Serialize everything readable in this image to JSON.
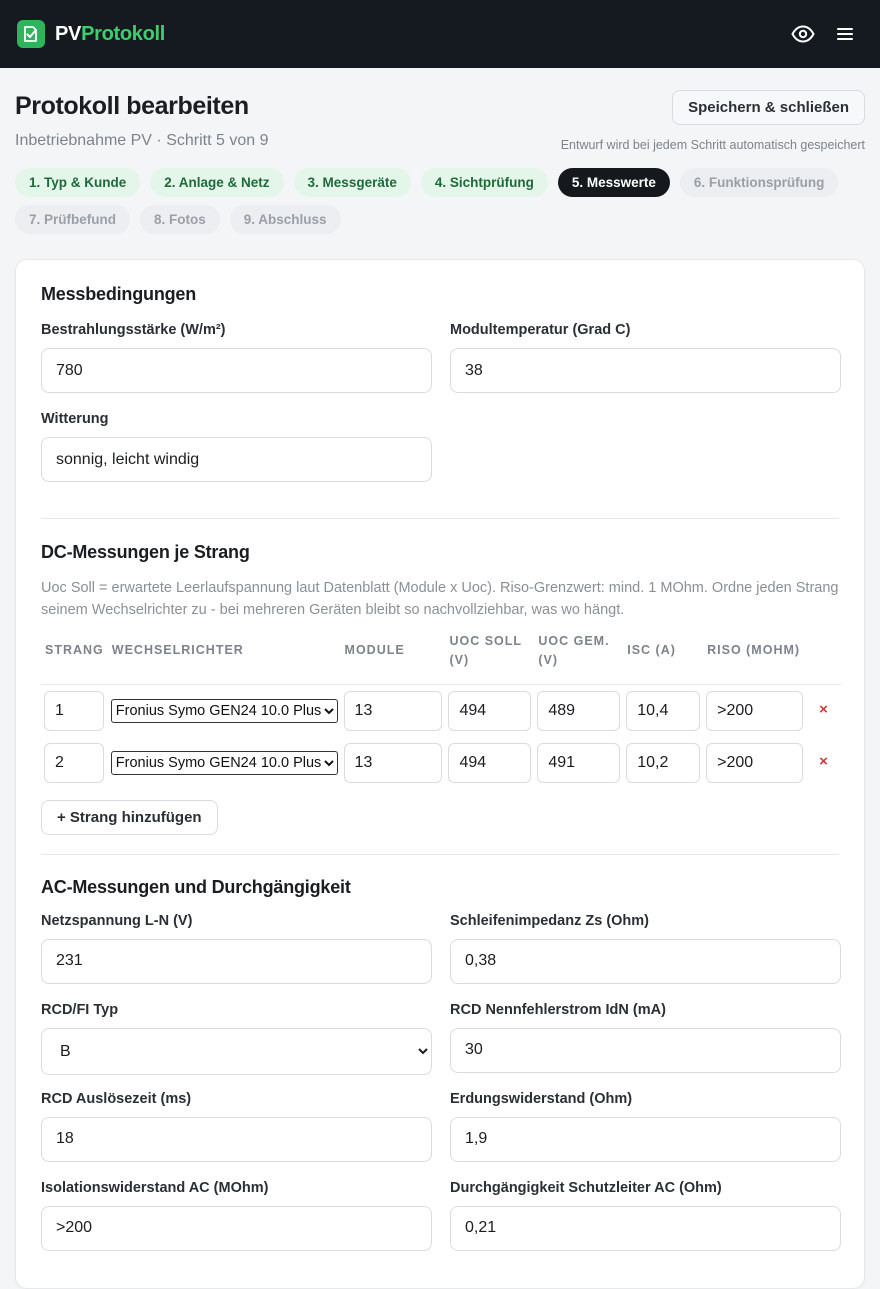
{
  "app": {
    "brand_part1": "PV",
    "brand_part2": "Protokoll",
    "colors": {
      "accent": "#3ccf6e",
      "topbar": "#151a21"
    }
  },
  "header": {
    "title": "Protokoll bearbeiten",
    "subtitle": "Inbetriebnahme PV · Schritt 5 von 9",
    "save_label": "Speichern & schließen",
    "autosave_note": "Entwurf wird bei jedem Schritt automatisch gespeichert"
  },
  "steps": [
    {
      "label": "1. Typ & Kunde",
      "state": "done"
    },
    {
      "label": "2. Anlage & Netz",
      "state": "done"
    },
    {
      "label": "3. Messgeräte",
      "state": "done"
    },
    {
      "label": "4. Sichtprüfung",
      "state": "done"
    },
    {
      "label": "5. Messwerte",
      "state": "active"
    },
    {
      "label": "6. Funktionsprüfung",
      "state": "todo"
    },
    {
      "label": "7. Prüfbefund",
      "state": "todo"
    },
    {
      "label": "8. Fotos",
      "state": "todo"
    },
    {
      "label": "9. Abschluss",
      "state": "todo"
    }
  ],
  "conditions": {
    "title": "Messbedingungen",
    "irradiance_label": "Bestrahlungsstärke (W/m²)",
    "irradiance_value": "780",
    "module_temp_label": "Modultemperatur (Grad C)",
    "module_temp_value": "38",
    "weather_label": "Witterung",
    "weather_value": "sonnig, leicht windig"
  },
  "dc": {
    "title": "DC-Messungen je Strang",
    "hint": "Uoc Soll = erwartete Leerlaufspannung laut Datenblatt (Module x Uoc). Riso-Grenzwert: mind. 1 MOhm. Ordne jeden Strang seinem Wechselrichter zu - bei mehreren Geräten bleibt so nachvollziehbar, was wo hängt.",
    "columns": {
      "strang": "STRANG",
      "inverter": "WECHSELRICHTER",
      "modules": "MODULE",
      "uoc_soll_1": "UOC SOLL",
      "uoc_soll_2": "(V)",
      "uoc_gem_1": "UOC GEM.",
      "uoc_gem_2": "(V)",
      "isc": "ISC (A)",
      "riso": "RISO (MOHM)"
    },
    "rows": [
      {
        "strang": "1",
        "inverter": "Fronius Symo GEN24 10.0 Plus",
        "modules": "13",
        "uoc_soll": "494",
        "uoc_gem": "489",
        "isc": "10,4",
        "riso": ">200",
        "delete": "×"
      },
      {
        "strang": "2",
        "inverter": "Fronius Symo GEN24 10.0 Plus",
        "modules": "13",
        "uoc_soll": "494",
        "uoc_gem": "491",
        "isc": "10,2",
        "riso": ">200",
        "delete": "×"
      }
    ],
    "add_label": "+ Strang hinzufügen"
  },
  "ac": {
    "title": "AC-Messungen und Durchgängigkeit",
    "voltage_label": "Netzspannung L-N (V)",
    "voltage_value": "231",
    "loop_label": "Schleifenimpedanz Zs (Ohm)",
    "loop_value": "0,38",
    "rcd_type_label": "RCD/FI Typ",
    "rcd_type_value": "B",
    "rcd_current_label": "RCD Nennfehlerstrom IdN (mA)",
    "rcd_current_value": "30",
    "rcd_time_label": "RCD Auslösezeit (ms)",
    "rcd_time_value": "18",
    "earth_label": "Erdungswiderstand (Ohm)",
    "earth_value": "1,9",
    "insulation_label": "Isolationswiderstand AC (MOhm)",
    "insulation_value": ">200",
    "continuity_label": "Durchgängigkeit Schutzleiter AC (Ohm)",
    "continuity_value": "0,21"
  }
}
